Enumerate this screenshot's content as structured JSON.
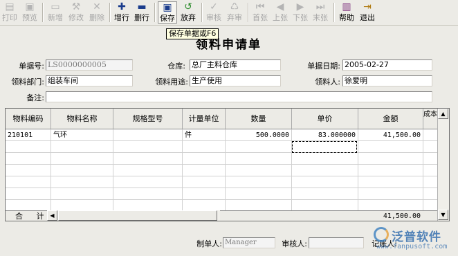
{
  "toolbar": {
    "print": "打印",
    "preview": "预览",
    "add": "新增",
    "edit": "修改",
    "delete": "删除",
    "add_row": "增行",
    "delete_row": "删行",
    "save": "保存",
    "discard": "放弃",
    "audit": "审核",
    "unaudit": "弃审",
    "first": "首张",
    "prev": "上张",
    "next": "下张",
    "last": "末张",
    "help": "帮助",
    "exit": "退出"
  },
  "tooltip": "保存单据或F6",
  "form": {
    "title": "领料申请单",
    "doc_no_label": "单据号:",
    "doc_no_value": "LS0000000005",
    "warehouse_label": "仓库:",
    "warehouse_value": "总厂主料仓库",
    "date_label": "单据日期:",
    "date_value": "2005-02-27",
    "dept_label": "领料部门:",
    "dept_value": "组装车间",
    "usage_label": "领料用途:",
    "usage_value": "生产使用",
    "receiver_label": "领料人:",
    "receiver_value": "徐爱明",
    "remark_label": "备注:",
    "remark_value": ""
  },
  "table": {
    "columns": [
      "物料编码",
      "物料名称",
      "规格型号",
      "计量单位",
      "数量",
      "单价",
      "金额",
      "成本"
    ],
    "rows": [
      {
        "code": "210101",
        "name": "气环",
        "spec": "",
        "unit": "件",
        "qty": "500.0000",
        "price": "83.000000",
        "amount": "41,500.00"
      }
    ],
    "total_label": "合 计",
    "total_amount": "41,500.00"
  },
  "footer": {
    "maker_label": "制单人:",
    "maker_value": "Manager",
    "auditor_label": "审核人:",
    "auditor_value": "",
    "bookkeeper_label": "记账人:"
  },
  "watermark": {
    "brand": "泛普软件",
    "url": "www.fanpusoft.com"
  }
}
